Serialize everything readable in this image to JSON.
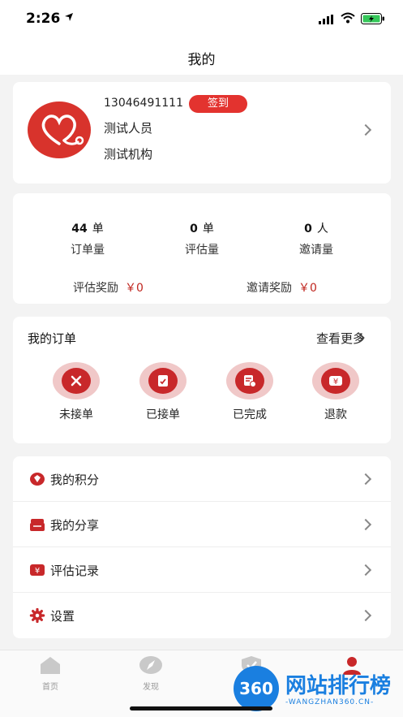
{
  "status_bar": {
    "time": "2:26"
  },
  "nav": {
    "title": "我的"
  },
  "profile": {
    "phone": "13046491111",
    "checkin_label": "签到",
    "name": "测试人员",
    "org": "测试机构"
  },
  "stats": {
    "items": [
      {
        "value": "44",
        "unit": "单",
        "label": "订单量"
      },
      {
        "value": "0",
        "unit": "单",
        "label": "评估量"
      },
      {
        "value": "0",
        "unit": "人",
        "label": "邀请量"
      }
    ],
    "rewards": [
      {
        "label": "评估奖励",
        "value": "￥0"
      },
      {
        "label": "邀请奖励",
        "value": "￥0"
      }
    ]
  },
  "orders": {
    "title": "我的订单",
    "more_label": "查看更多",
    "items": [
      {
        "label": "未接单",
        "icon": "x-icon"
      },
      {
        "label": "已接单",
        "icon": "doc-icon"
      },
      {
        "label": "已完成",
        "icon": "done-icon"
      },
      {
        "label": "退款",
        "icon": "yen-icon"
      }
    ]
  },
  "menu": {
    "items": [
      {
        "label": "我的积分",
        "icon": "points-icon"
      },
      {
        "label": "我的分享",
        "icon": "share-icon"
      },
      {
        "label": "评估记录",
        "icon": "record-icon"
      },
      {
        "label": "设置",
        "icon": "gear-icon"
      }
    ]
  },
  "tabs": {
    "items": [
      {
        "label": "首页"
      },
      {
        "label": "发现"
      },
      {
        "label": ""
      },
      {
        "label": ""
      }
    ]
  },
  "watermark": {
    "badge": "360",
    "title": "网站排行榜",
    "subtitle": "-WANGZHAN360.CN-"
  },
  "colors": {
    "accent": "#e3332f",
    "icon_red": "#c8282a",
    "price_red": "#c0261f"
  }
}
